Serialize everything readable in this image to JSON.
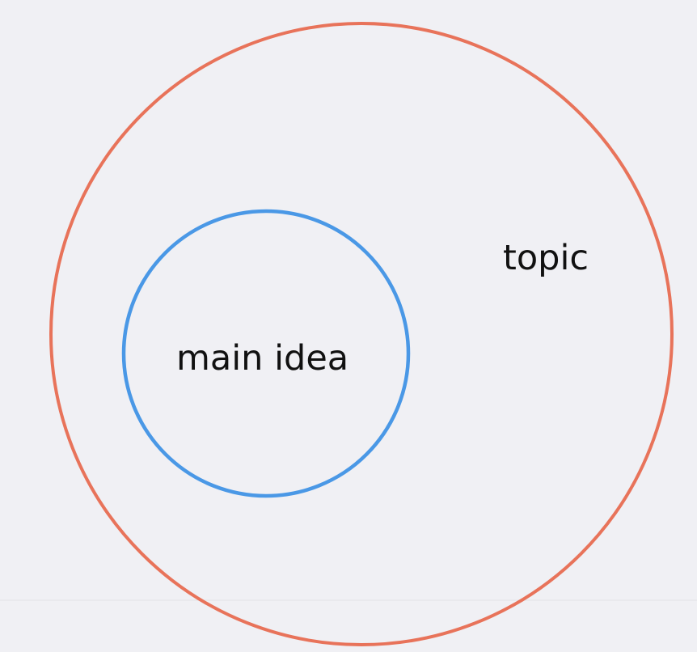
{
  "diagram": {
    "outer_circle": {
      "label": "topic",
      "color": "#e8735a"
    },
    "inner_circle": {
      "label": "main idea",
      "color": "#4a98e6"
    },
    "background": "#f0f0f4"
  }
}
